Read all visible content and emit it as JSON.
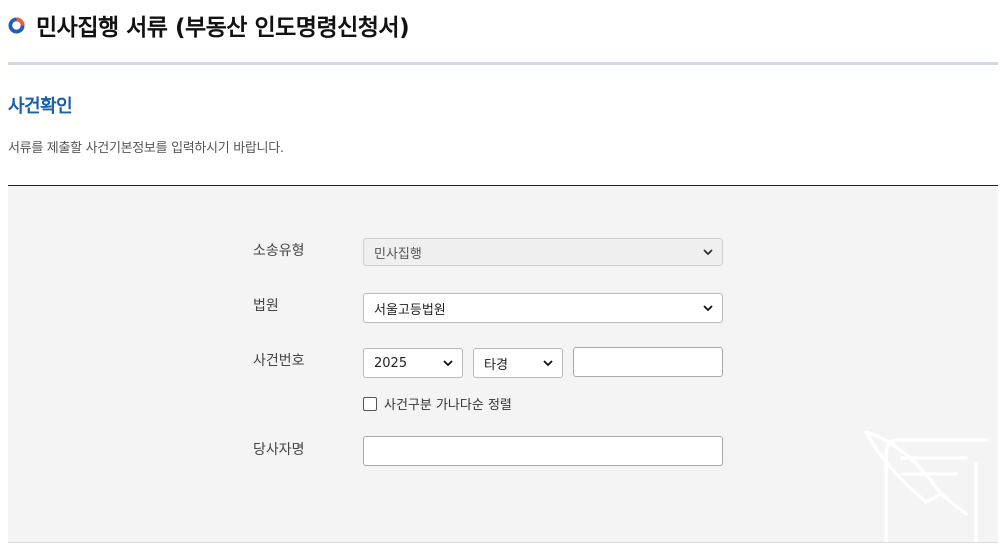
{
  "header": {
    "title": "민사집행 서류 (부동산 인도명령신청서)",
    "title_icon": "ring-bullet-icon"
  },
  "section": {
    "title": "사건확인",
    "description": "서류를 제출할 사건기본정보를 입력하시기 바랍니다."
  },
  "form": {
    "case_type": {
      "label": "소송유형",
      "value": "민사집행",
      "disabled": true
    },
    "court": {
      "label": "법원",
      "value": "서울고등법원"
    },
    "case_number": {
      "label": "사건번호",
      "year": "2025",
      "category": "타경",
      "serial": ""
    },
    "sort_checkbox": {
      "label": "사건구분 가나다순 정렬",
      "checked": false
    },
    "party_name": {
      "label": "당사자명",
      "value": ""
    }
  },
  "colors": {
    "accent": "#1a5fa8",
    "bullet_blue": "#1f5db8",
    "bullet_orange": "#e8632b",
    "form_bg": "#f4f4f5"
  },
  "decoration": {
    "icon": "quill-document-icon"
  }
}
